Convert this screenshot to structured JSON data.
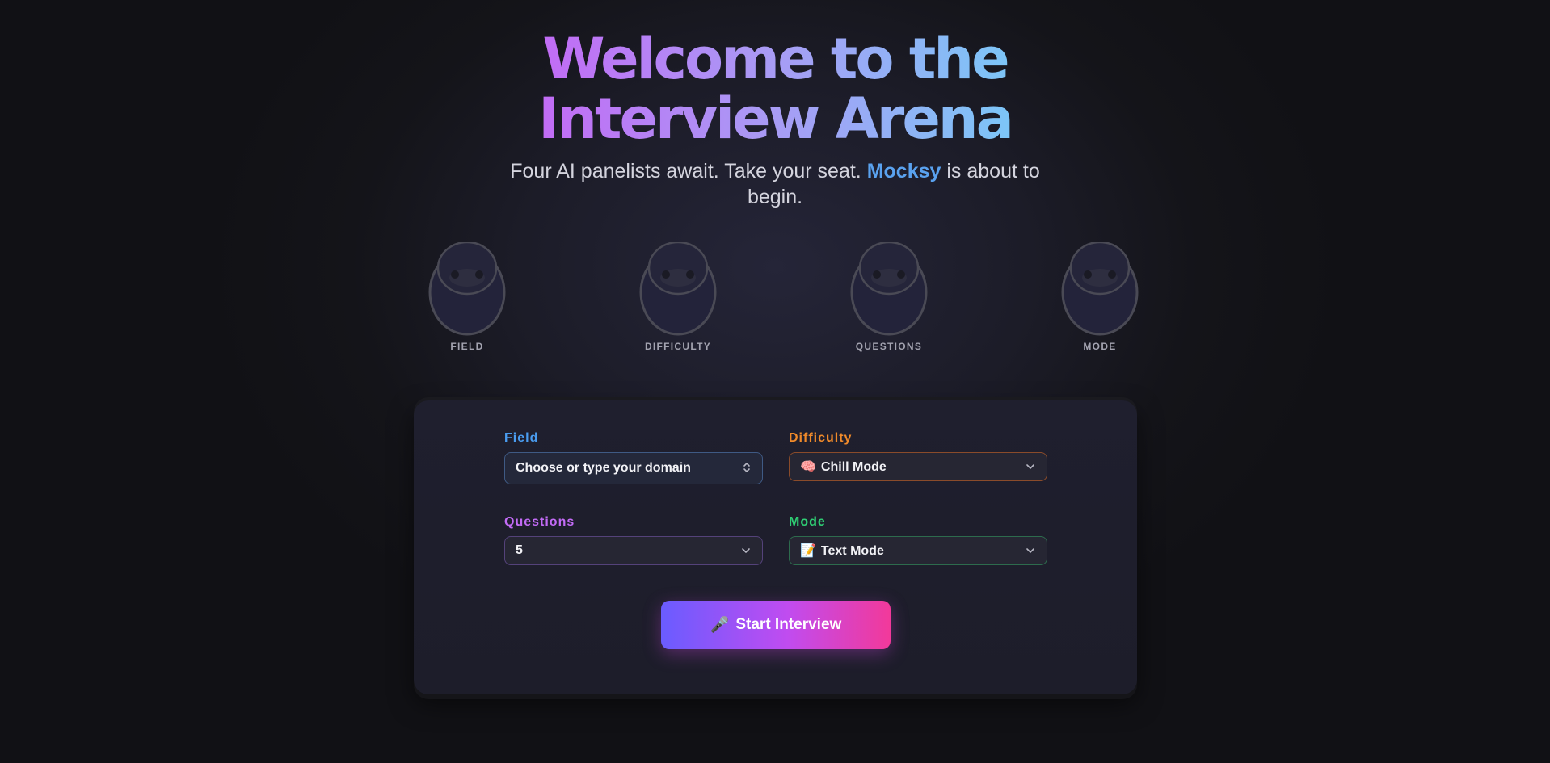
{
  "hero": {
    "title_line1": "Welcome to the",
    "title_line2": "Interview Arena",
    "subtitle_before": "Four AI panelists await. Take your seat.",
    "brand": "Mocksy",
    "subtitle_after": "is about to begin."
  },
  "panelists": [
    {
      "label": "FIELD"
    },
    {
      "label": "DIFFICULTY"
    },
    {
      "label": "QUESTIONS"
    },
    {
      "label": "MODE"
    }
  ],
  "form": {
    "field": {
      "label": "Field",
      "value": "Choose or type your domain",
      "color": "#4a9cf0"
    },
    "difficulty": {
      "label": "Difficulty",
      "emoji": "🧠",
      "value": "Chill Mode",
      "color": "#f08a2a"
    },
    "questions": {
      "label": "Questions",
      "value": "5",
      "color": "#c26bf5"
    },
    "mode": {
      "label": "Mode",
      "emoji": "📝",
      "value": "Text Mode",
      "color": "#2fce74"
    }
  },
  "start_button": {
    "emoji": "🎤",
    "label": "Start Interview"
  },
  "icons": {
    "field_control": "updown-chevron-icon",
    "select_arrow": "chevron-down-icon",
    "avatar": "panelist-avatar-icon"
  }
}
